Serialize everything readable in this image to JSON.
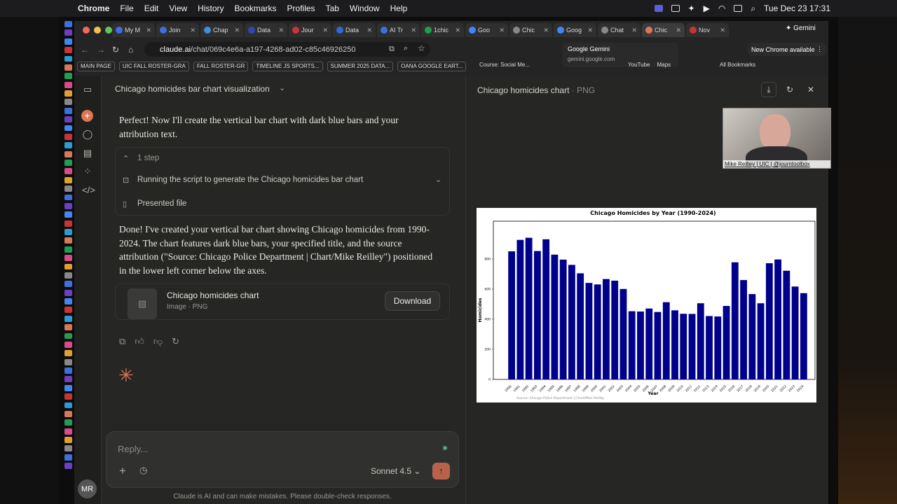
{
  "macos": {
    "app": "Chrome",
    "menus": [
      "File",
      "Edit",
      "View",
      "History",
      "Bookmarks",
      "Profiles",
      "Tab",
      "Window",
      "Help"
    ],
    "clock": "Tue Dec 23  17:31"
  },
  "browser": {
    "tabs": [
      {
        "label": "My M",
        "color": "#3d6fe0"
      },
      {
        "label": "Join",
        "color": "#3d6fe0"
      },
      {
        "label": "Chap",
        "color": "#3a8fe0"
      },
      {
        "label": "Data",
        "color": "#2b4ab0"
      },
      {
        "label": "Jour",
        "color": "#c33"
      },
      {
        "label": "Data",
        "color": "#2d6bd6"
      },
      {
        "label": "AI Tr",
        "color": "#3d6fe0"
      },
      {
        "label": "1chic",
        "color": "#1f9d55"
      },
      {
        "label": "Goo",
        "color": "#4285f4"
      },
      {
        "label": "Chic",
        "color": "#888"
      },
      {
        "label": "Goog",
        "color": "#4285f4"
      },
      {
        "label": "Chat",
        "color": "#888"
      },
      {
        "label": "Chic",
        "color": "#d97757",
        "active": true
      },
      {
        "label": "Nov",
        "color": "#c33"
      }
    ],
    "gemini_tab": "Gemini",
    "url_host": "claude.ai",
    "url_path": "/chat/069c4e6a-a197-4268-ad02-c85c46926250",
    "new_chrome": "New Chrome available",
    "tooltip_title": "Google Gemini",
    "tooltip_url": "gemini.google.com",
    "bookmarks": [
      "MAIN PAGE",
      "UIC FALL ROSTER-GRA",
      "FALL ROSTER-GR",
      "TIMELINE JS SPORTS...",
      "SUMMER 2025 DATA...",
      "OANA GOOGLE EART..."
    ],
    "bookmarks_right": [
      "Course: Social Me...",
      "YouTube",
      "Maps",
      "All Bookmarks"
    ]
  },
  "chat": {
    "title": "Chicago homicides bar chart visualization",
    "msg1": "Perfect! Now I'll create the vertical bar chart with dark blue bars and your attribution text.",
    "steps_label": "1 step",
    "step_running": "Running the script to generate the Chicago homicides bar chart",
    "step_presented": "Presented file",
    "msg2": "Done! I've created your vertical bar chart showing Chicago homicides from 1990-2024. The chart features dark blue bars, your specified title, and the source attribution (\"Source: Chicago Police Department | Chart/Mike Reilley\") positioned in the lower left corner below the axes.",
    "file_name": "Chicago homicides chart",
    "file_meta": "Image · PNG",
    "download": "Download",
    "reply_placeholder": "Reply...",
    "model": "Sonnet 4.5",
    "disclaimer": "Claude is AI and can make mistakes. Please double-check responses.",
    "avatar": "MR"
  },
  "artifact": {
    "title": "Chicago homicides chart",
    "type": " · PNG"
  },
  "webcam": {
    "caption": "Mike Reilley | UIC | @journtoolbox"
  },
  "chart_data": {
    "type": "bar",
    "title": "Chicago Homicides by Year (1990-2024)",
    "xlabel": "Year",
    "ylabel": "Homicides",
    "source": "Source: Chicago Police Department | Chart/Mike Reilley",
    "bar_color": "#00008b",
    "ylim": [
      0,
      1000
    ],
    "yticks": [
      0,
      200,
      400,
      600,
      800
    ],
    "grid": false,
    "categories": [
      "1990",
      "1991",
      "1992",
      "1993",
      "1994",
      "1995",
      "1996",
      "1997",
      "1998",
      "1999",
      "2000",
      "2001",
      "2002",
      "2003",
      "2004",
      "2005",
      "2006",
      "2007",
      "2008",
      "2009",
      "2010",
      "2011",
      "2012",
      "2013",
      "2014",
      "2015",
      "2016",
      "2017",
      "2018",
      "2019",
      "2020",
      "2021",
      "2022",
      "2023",
      "2024"
    ],
    "values": [
      851,
      927,
      941,
      853,
      931,
      829,
      796,
      761,
      705,
      641,
      631,
      667,
      656,
      601,
      453,
      451,
      471,
      448,
      513,
      459,
      436,
      435,
      506,
      421,
      418,
      488,
      778,
      660,
      567,
      506,
      772,
      797,
      722,
      617,
      573
    ]
  }
}
